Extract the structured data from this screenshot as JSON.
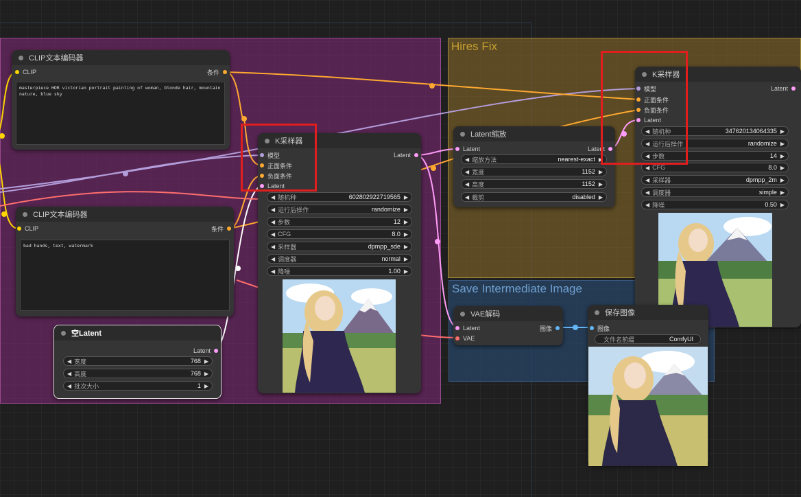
{
  "groups": {
    "hires_title": "Hires Fix",
    "save_title": "Save Intermediate Image"
  },
  "clip_pos": {
    "title": "CLIP文本编码器",
    "in_clip": "CLIP",
    "out_cond": "条件",
    "text": "masterpiece HDR victorian portrait painting of woman, blonde hair, mountain nature, blue sky"
  },
  "clip_neg": {
    "title": "CLIP文本编码器",
    "in_clip": "CLIP",
    "out_cond": "条件",
    "text": "bad hands, text, watermark"
  },
  "empty_latent": {
    "title": "空Latent",
    "out_latent": "Latent",
    "widgets": [
      {
        "label": "宽度",
        "value": "768"
      },
      {
        "label": "高度",
        "value": "768"
      },
      {
        "label": "批次大小",
        "value": "1"
      }
    ]
  },
  "ksampler1": {
    "title": "K采样器",
    "inputs": [
      "模型",
      "正面条件",
      "负面条件",
      "Latent"
    ],
    "out_latent": "Latent",
    "widgets": [
      {
        "label": "随机种",
        "value": "602802922719565"
      },
      {
        "label": "运行后操作",
        "value": "randomize"
      },
      {
        "label": "步数",
        "value": "12"
      },
      {
        "label": "CFG",
        "value": "8.0"
      },
      {
        "label": "采样器",
        "value": "dpmpp_sde"
      },
      {
        "label": "调度器",
        "value": "normal"
      },
      {
        "label": "降噪",
        "value": "1.00"
      }
    ]
  },
  "latent_upscale": {
    "title": "Latent缩放",
    "in_latent": "Latent",
    "out_latent": "Latent",
    "widgets": [
      {
        "label": "缩放方法",
        "value": "nearest-exact"
      },
      {
        "label": "宽度",
        "value": "1152"
      },
      {
        "label": "高度",
        "value": "1152"
      },
      {
        "label": "裁剪",
        "value": "disabled"
      }
    ]
  },
  "ksampler2": {
    "title": "K采样器",
    "inputs": [
      "模型",
      "正面条件",
      "负面条件",
      "Latent"
    ],
    "out_latent": "Latent",
    "widgets": [
      {
        "label": "随机种",
        "value": "347620134064335"
      },
      {
        "label": "运行后操作",
        "value": "randomize"
      },
      {
        "label": "步数",
        "value": "14"
      },
      {
        "label": "CFG",
        "value": "8.0"
      },
      {
        "label": "采样器",
        "value": "dpmpp_2m"
      },
      {
        "label": "调度器",
        "value": "simple"
      },
      {
        "label": "降噪",
        "value": "0.50"
      }
    ]
  },
  "vae_decode": {
    "title": "VAE解码",
    "inputs": [
      "Latent",
      "VAE"
    ],
    "out_image": "图像"
  },
  "save_image": {
    "title": "保存图像",
    "in_image": "图像",
    "prefix_label": "文件名前缀",
    "prefix_value": "ComfyUI"
  },
  "colors": {
    "model": "#b39ddb",
    "conditioning": "#ffa931",
    "latent": "#ff9cf9",
    "vae": "#ff6e6e",
    "clip": "#ffd500",
    "image": "#64b5f6",
    "highlight": "#e01e1e"
  }
}
